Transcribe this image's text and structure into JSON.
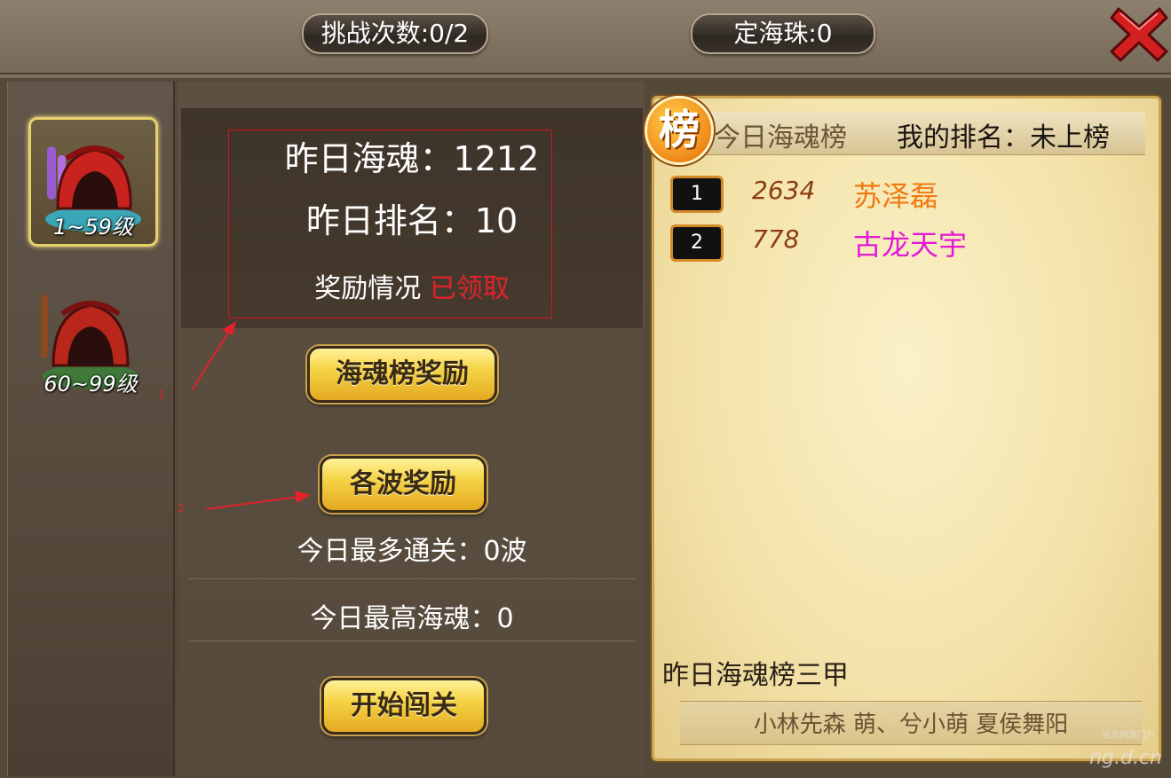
{
  "header": {
    "challenge_count": "挑战次数:0/2",
    "pearl_count": "定海珠:0"
  },
  "tiers": [
    {
      "label": "1~59级",
      "selected": true
    },
    {
      "label": "60~99级",
      "selected": false
    }
  ],
  "info": {
    "yesterday_soul": "昨日海魂：1212",
    "yesterday_rank": "昨日排名：10",
    "reward_status_label": "奖励情况",
    "reward_status_value": "已领取"
  },
  "buttons": {
    "soul_rank_reward": "海魂榜奖励",
    "wave_reward": "各波奖励",
    "start": "开始闯关"
  },
  "stats": {
    "today_max_wave": "今日最多通关：0波",
    "today_max_soul": "今日最高海魂：0"
  },
  "annotations": {
    "arrow_1": "1",
    "arrow_2": "2"
  },
  "board": {
    "badge": "榜",
    "title": "今日海魂榜",
    "my_rank": "我的排名：未上榜",
    "entries": [
      {
        "rank": "1",
        "score": "2634",
        "name": "苏泽磊"
      },
      {
        "rank": "2",
        "score": "778",
        "name": "古龙天宇"
      }
    ],
    "top3_label": "昨日海魂榜三甲",
    "top3_names": "小林先森 萌、兮小萌 夏侯舞阳"
  },
  "watermark": {
    "text": "ng.d.cn",
    "sub": "当乐网游门户"
  },
  "colors": {
    "gold_button": "#f5d446",
    "claimed_red": "#e3222a",
    "rank1_name": "#f07a10",
    "rank2_name": "#e21ad6"
  }
}
